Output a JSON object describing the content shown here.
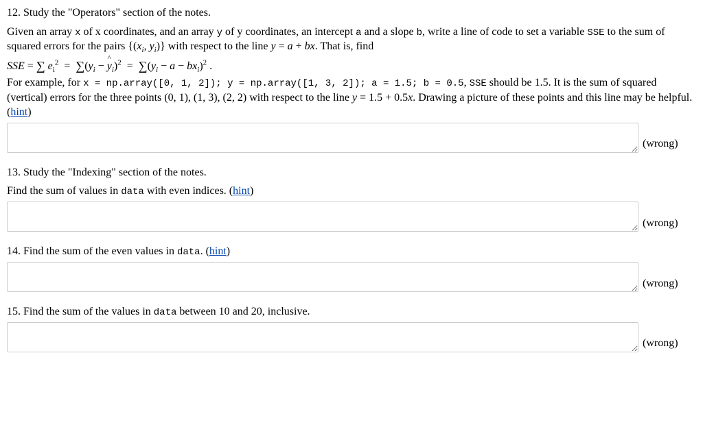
{
  "q12": {
    "number": "12.",
    "title": "Study the \"Operators\" section of the notes.",
    "p1_a": "Given an array ",
    "p1_x": "x",
    "p1_b": " of x coordinates, and an array ",
    "p1_y": "y",
    "p1_c": " of y coordinates, an intercept ",
    "p1_aparam": "a",
    "p1_d": " and a slope ",
    "p1_bparam": "b",
    "p1_e": ", write a line of code to set a variable ",
    "p1_sse": "SSE",
    "p1_f": " to the sum of squared errors for the pairs {(",
    "p1_g": ")} with respect to the line ",
    "p1_h": ". That is, find",
    "p3_a": "For example, for ",
    "p3_code": "x = np.array([0, 1, 2]); y = np.array([1, 3, 2]); a = 1.5; b = 0.5",
    "p3_b": ", ",
    "p3_sse": "SSE",
    "p3_c": " should be 1.5. It is the sum of squared (vertical) errors for the three points (0, 1), (1, 3), (2, 2) with respect to the line ",
    "p3_d": ". Drawing a picture of these points and this line may be helpful. (",
    "hint": "hint",
    "p3_e": ")",
    "status": "(wrong)"
  },
  "q13": {
    "number": "13.",
    "title": "Study the \"Indexing\" section of the notes.",
    "p_a": "Find the sum of values in ",
    "p_data": "data",
    "p_b": " with even indices. (",
    "hint": "hint",
    "p_c": ")",
    "status": "(wrong)"
  },
  "q14": {
    "number": "14.",
    "p_a": "Find the sum of the even values in ",
    "p_data": "data",
    "p_b": ". (",
    "hint": "hint",
    "p_c": ")",
    "status": "(wrong)"
  },
  "q15": {
    "number": "15.",
    "p_a": "Find the sum of the values in ",
    "p_data": "data",
    "p_b": " between 10 and 20, inclusive.",
    "status": "(wrong)"
  }
}
